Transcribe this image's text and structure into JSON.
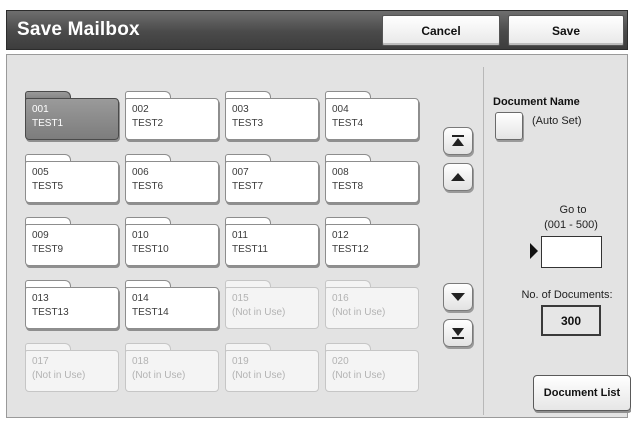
{
  "header": {
    "title": "Save Mailbox",
    "cancel_label": "Cancel",
    "save_label": "Save"
  },
  "mailboxes": [
    {
      "number": "001",
      "name": "TEST1",
      "state": "selected"
    },
    {
      "number": "002",
      "name": "TEST2",
      "state": "in-use"
    },
    {
      "number": "003",
      "name": "TEST3",
      "state": "in-use"
    },
    {
      "number": "004",
      "name": "TEST4",
      "state": "in-use"
    },
    {
      "number": "005",
      "name": "TEST5",
      "state": "in-use"
    },
    {
      "number": "006",
      "name": "TEST6",
      "state": "in-use"
    },
    {
      "number": "007",
      "name": "TEST7",
      "state": "in-use"
    },
    {
      "number": "008",
      "name": "TEST8",
      "state": "in-use"
    },
    {
      "number": "009",
      "name": "TEST9",
      "state": "in-use"
    },
    {
      "number": "010",
      "name": "TEST10",
      "state": "in-use"
    },
    {
      "number": "011",
      "name": "TEST11",
      "state": "in-use"
    },
    {
      "number": "012",
      "name": "TEST12",
      "state": "in-use"
    },
    {
      "number": "013",
      "name": "TEST13",
      "state": "in-use"
    },
    {
      "number": "014",
      "name": "TEST14",
      "state": "in-use"
    },
    {
      "number": "015",
      "name": "(Not in Use)",
      "state": "unused"
    },
    {
      "number": "016",
      "name": "(Not in Use)",
      "state": "unused"
    },
    {
      "number": "017",
      "name": "(Not in Use)",
      "state": "unused"
    },
    {
      "number": "018",
      "name": "(Not in Use)",
      "state": "unused"
    },
    {
      "number": "019",
      "name": "(Not in Use)",
      "state": "unused"
    },
    {
      "number": "020",
      "name": "(Not in Use)",
      "state": "unused"
    }
  ],
  "scroll": {
    "top_icon": "scroll-to-top-icon",
    "up_icon": "scroll-up-icon",
    "down_icon": "scroll-down-icon",
    "bottom_icon": "scroll-to-bottom-icon"
  },
  "document_name": {
    "label": "Document Name",
    "auto_set": "(Auto Set)"
  },
  "go_to": {
    "label": "Go to",
    "range": "(001 - 500)",
    "value": ""
  },
  "documents": {
    "label": "No. of Documents:",
    "count": "300"
  },
  "document_list_label": "Document List"
}
